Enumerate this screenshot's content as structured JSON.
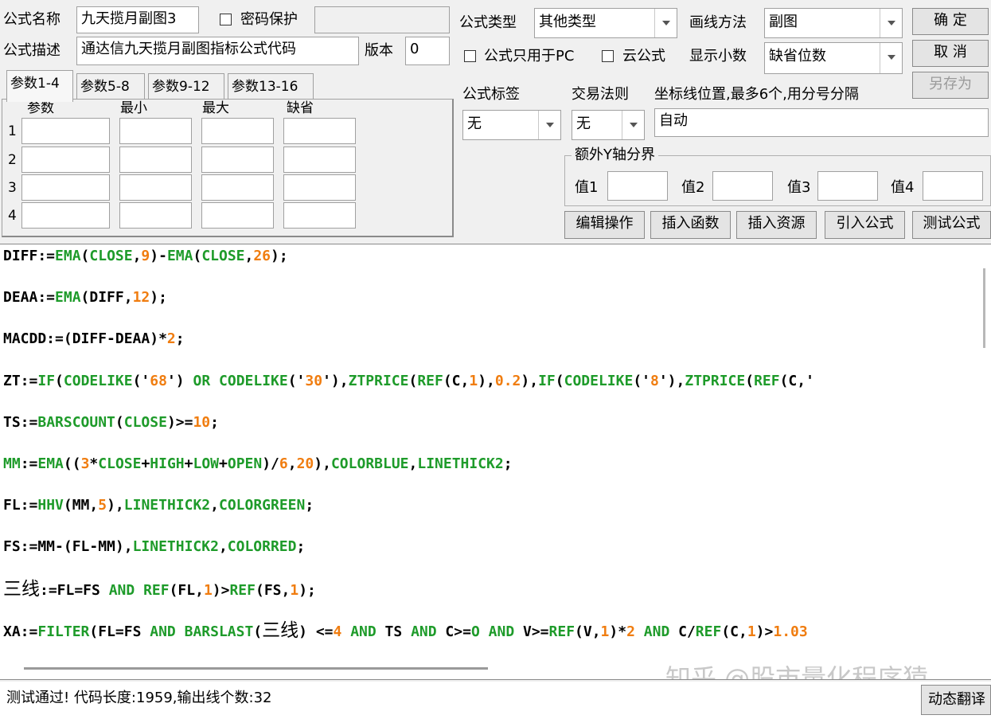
{
  "form": {
    "name_label": "公式名称",
    "name_value": "九天揽月副图3",
    "password_label": "密码保护",
    "desc_label": "公式描述",
    "desc_value": "通达信九天揽月副图指标公式代码",
    "version_label": "版本",
    "version_value": "0",
    "type_label": "公式类型",
    "type_value": "其他类型",
    "draw_label": "画线方法",
    "draw_value": "副图",
    "pc_only_label": "公式只用于PC",
    "cloud_label": "云公式",
    "decimal_label": "显示小数",
    "decimal_value": "缺省位数",
    "tag_label": "公式标签",
    "tag_value": "无",
    "rule_label": "交易法则",
    "rule_value": "无",
    "axis_label": "坐标线位置,最多6个,用分号分隔",
    "axis_value": "自动",
    "extra_y_label": "额外Y轴分界",
    "v1_label": "值1",
    "v2_label": "值2",
    "v3_label": "值3",
    "v4_label": "值4"
  },
  "buttons": {
    "ok": "确  定",
    "cancel": "取  消",
    "save_as": "另存为",
    "edit_ops": "编辑操作",
    "insert_func": "插入函数",
    "insert_res": "插入资源",
    "import_formula": "引入公式",
    "test_formula": "测试公式",
    "dyn_translate": "动态翻译"
  },
  "params": {
    "tabs": [
      "参数1-4",
      "参数5-8",
      "参数9-12",
      "参数13-16"
    ],
    "headers": [
      "参数",
      "最小",
      "最大",
      "缺省"
    ],
    "rows": [
      "1",
      "2",
      "3",
      "4"
    ]
  },
  "code_lines": [
    [
      [
        "t",
        "DIFF:="
      ],
      [
        "f",
        "EMA"
      ],
      [
        "t",
        "("
      ],
      [
        "f",
        "CLOSE"
      ],
      [
        "t",
        ","
      ],
      [
        "n",
        "9"
      ],
      [
        "t",
        ")-"
      ],
      [
        "f",
        "EMA"
      ],
      [
        "t",
        "("
      ],
      [
        "f",
        "CLOSE"
      ],
      [
        "t",
        ","
      ],
      [
        "n",
        "26"
      ],
      [
        "t",
        ");"
      ]
    ],
    [
      [
        "t",
        "DEAA:="
      ],
      [
        "f",
        "EMA"
      ],
      [
        "t",
        "(DIFF,"
      ],
      [
        "n",
        "12"
      ],
      [
        "t",
        ");"
      ]
    ],
    [
      [
        "t",
        "MACDD:=(DIFF-DEAA)*"
      ],
      [
        "n",
        "2"
      ],
      [
        "t",
        ";"
      ]
    ],
    [
      [
        "t",
        "ZT:="
      ],
      [
        "f",
        "IF"
      ],
      [
        "t",
        "("
      ],
      [
        "f",
        "CODELIKE"
      ],
      [
        "t",
        "('"
      ],
      [
        "n",
        "68"
      ],
      [
        "t",
        "') "
      ],
      [
        "f",
        "OR"
      ],
      [
        "t",
        " "
      ],
      [
        "f",
        "CODELIKE"
      ],
      [
        "t",
        "('"
      ],
      [
        "n",
        "30"
      ],
      [
        "t",
        "'),"
      ],
      [
        "f",
        "ZTPRICE"
      ],
      [
        "t",
        "("
      ],
      [
        "f",
        "REF"
      ],
      [
        "t",
        "(C,"
      ],
      [
        "n",
        "1"
      ],
      [
        "t",
        "),"
      ],
      [
        "n",
        "0.2"
      ],
      [
        "t",
        "),"
      ],
      [
        "f",
        "IF"
      ],
      [
        "t",
        "("
      ],
      [
        "f",
        "CODELIKE"
      ],
      [
        "t",
        "('"
      ],
      [
        "n",
        "8"
      ],
      [
        "t",
        "'),"
      ],
      [
        "f",
        "ZTPRICE"
      ],
      [
        "t",
        "("
      ],
      [
        "f",
        "REF"
      ],
      [
        "t",
        "(C,'"
      ]
    ],
    [
      [
        "t",
        "TS:="
      ],
      [
        "f",
        "BARSCOUNT"
      ],
      [
        "t",
        "("
      ],
      [
        "f",
        "CLOSE"
      ],
      [
        "t",
        ")>="
      ],
      [
        "n",
        "10"
      ],
      [
        "t",
        ";"
      ]
    ],
    [
      [
        "f",
        "MM"
      ],
      [
        "t",
        ":="
      ],
      [
        "f",
        "EMA"
      ],
      [
        "t",
        "(("
      ],
      [
        "n",
        "3"
      ],
      [
        "t",
        "*"
      ],
      [
        "f",
        "CLOSE"
      ],
      [
        "t",
        "+"
      ],
      [
        "f",
        "HIGH"
      ],
      [
        "t",
        "+"
      ],
      [
        "f",
        "LOW"
      ],
      [
        "t",
        "+"
      ],
      [
        "f",
        "OPEN"
      ],
      [
        "t",
        ")/"
      ],
      [
        "n",
        "6"
      ],
      [
        "t",
        ","
      ],
      [
        "n",
        "20"
      ],
      [
        "t",
        "),"
      ],
      [
        "f",
        "COLORBLUE"
      ],
      [
        "t",
        ","
      ],
      [
        "f",
        "LINETHICK2"
      ],
      [
        "t",
        ";"
      ]
    ],
    [
      [
        "t",
        "FL:="
      ],
      [
        "f",
        "HHV"
      ],
      [
        "t",
        "(MM,"
      ],
      [
        "n",
        "5"
      ],
      [
        "t",
        "),"
      ],
      [
        "f",
        "LINETHICK2"
      ],
      [
        "t",
        ","
      ],
      [
        "f",
        "COLORGREEN"
      ],
      [
        "t",
        ";"
      ]
    ],
    [
      [
        "t",
        "FS:=MM-(FL-MM),"
      ],
      [
        "f",
        "LINETHICK2"
      ],
      [
        "t",
        ","
      ],
      [
        "f",
        "COLORRED"
      ],
      [
        "t",
        ";"
      ]
    ],
    [
      [
        "c",
        "三线"
      ],
      [
        "t",
        ":=FL=FS "
      ],
      [
        "f",
        "AND"
      ],
      [
        "t",
        " "
      ],
      [
        "f",
        "REF"
      ],
      [
        "t",
        "(FL,"
      ],
      [
        "n",
        "1"
      ],
      [
        "t",
        ")>"
      ],
      [
        "f",
        "REF"
      ],
      [
        "t",
        "(FS,"
      ],
      [
        "n",
        "1"
      ],
      [
        "t",
        ");"
      ]
    ],
    [
      [
        "t",
        "XA:="
      ],
      [
        "f",
        "FILTER"
      ],
      [
        "t",
        "(FL=FS "
      ],
      [
        "f",
        "AND"
      ],
      [
        "t",
        " "
      ],
      [
        "f",
        "BARSLAST"
      ],
      [
        "t",
        "("
      ],
      [
        "c",
        "三线"
      ],
      [
        "t",
        ") <="
      ],
      [
        "n",
        "4"
      ],
      [
        "t",
        " "
      ],
      [
        "f",
        "AND"
      ],
      [
        "t",
        " TS "
      ],
      [
        "f",
        "AND"
      ],
      [
        "t",
        " C>="
      ],
      [
        "f",
        "O"
      ],
      [
        "t",
        " "
      ],
      [
        "f",
        "AND"
      ],
      [
        "t",
        " V>="
      ],
      [
        "f",
        "REF"
      ],
      [
        "t",
        "(V,"
      ],
      [
        "n",
        "1"
      ],
      [
        "t",
        ")*"
      ],
      [
        "n",
        "2"
      ],
      [
        "t",
        " "
      ],
      [
        "f",
        "AND"
      ],
      [
        "t",
        " C/"
      ],
      [
        "f",
        "REF"
      ],
      [
        "t",
        "(C,"
      ],
      [
        "n",
        "1"
      ],
      [
        "t",
        ")>"
      ],
      [
        "n",
        "1.03"
      ]
    ]
  ],
  "status_text": "测试通过! 代码长度:1959,输出线个数:32",
  "watermark": "知乎 @股市量化程序猿"
}
